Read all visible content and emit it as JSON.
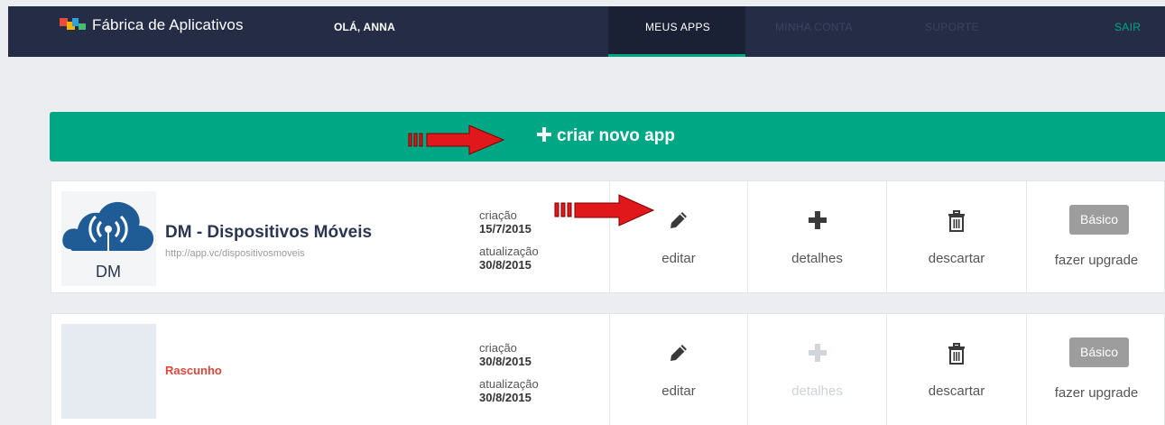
{
  "header": {
    "brand": "Fábrica de Aplicativos",
    "greeting": "OLÁ, ANNA",
    "nav": [
      {
        "label": "MEUS APPS",
        "active": true
      },
      {
        "label": "MINHA CONTA",
        "active": false
      },
      {
        "label": "SUPORTE",
        "active": false
      },
      {
        "label": "SAIR",
        "active": false
      }
    ]
  },
  "create_button": {
    "label": "criar novo app",
    "icon": "plus-icon"
  },
  "apps": [
    {
      "name": "DM - Dispositivos Móveis",
      "url": "http://app.vc/dispositivosmoveis",
      "thumb_text": "DM",
      "created_label": "criação",
      "created": "15/7/2015",
      "updated_label": "atualização",
      "updated": "30/8/2015",
      "actions": {
        "edit": "editar",
        "details": "detalhes",
        "discard": "descartar",
        "plan": "Básico",
        "upgrade": "fazer upgrade"
      }
    },
    {
      "status": "Rascunho",
      "created_label": "criação",
      "created": "30/8/2015",
      "updated_label": "atualização",
      "updated": "30/8/2015",
      "actions": {
        "edit": "editar",
        "details": "detalhes",
        "discard": "descartar",
        "plan": "Básico",
        "upgrade": "fazer upgrade"
      }
    }
  ],
  "colors": {
    "navbar": "#252c45",
    "accent": "#00a784",
    "draft": "#e0453a",
    "badge": "#9d9d9d",
    "arrow": "#e0181b"
  },
  "icons": [
    "pencil-icon",
    "plus-icon",
    "trash-icon",
    "red-arrow-annotation",
    "wifi-cloud-icon"
  ]
}
